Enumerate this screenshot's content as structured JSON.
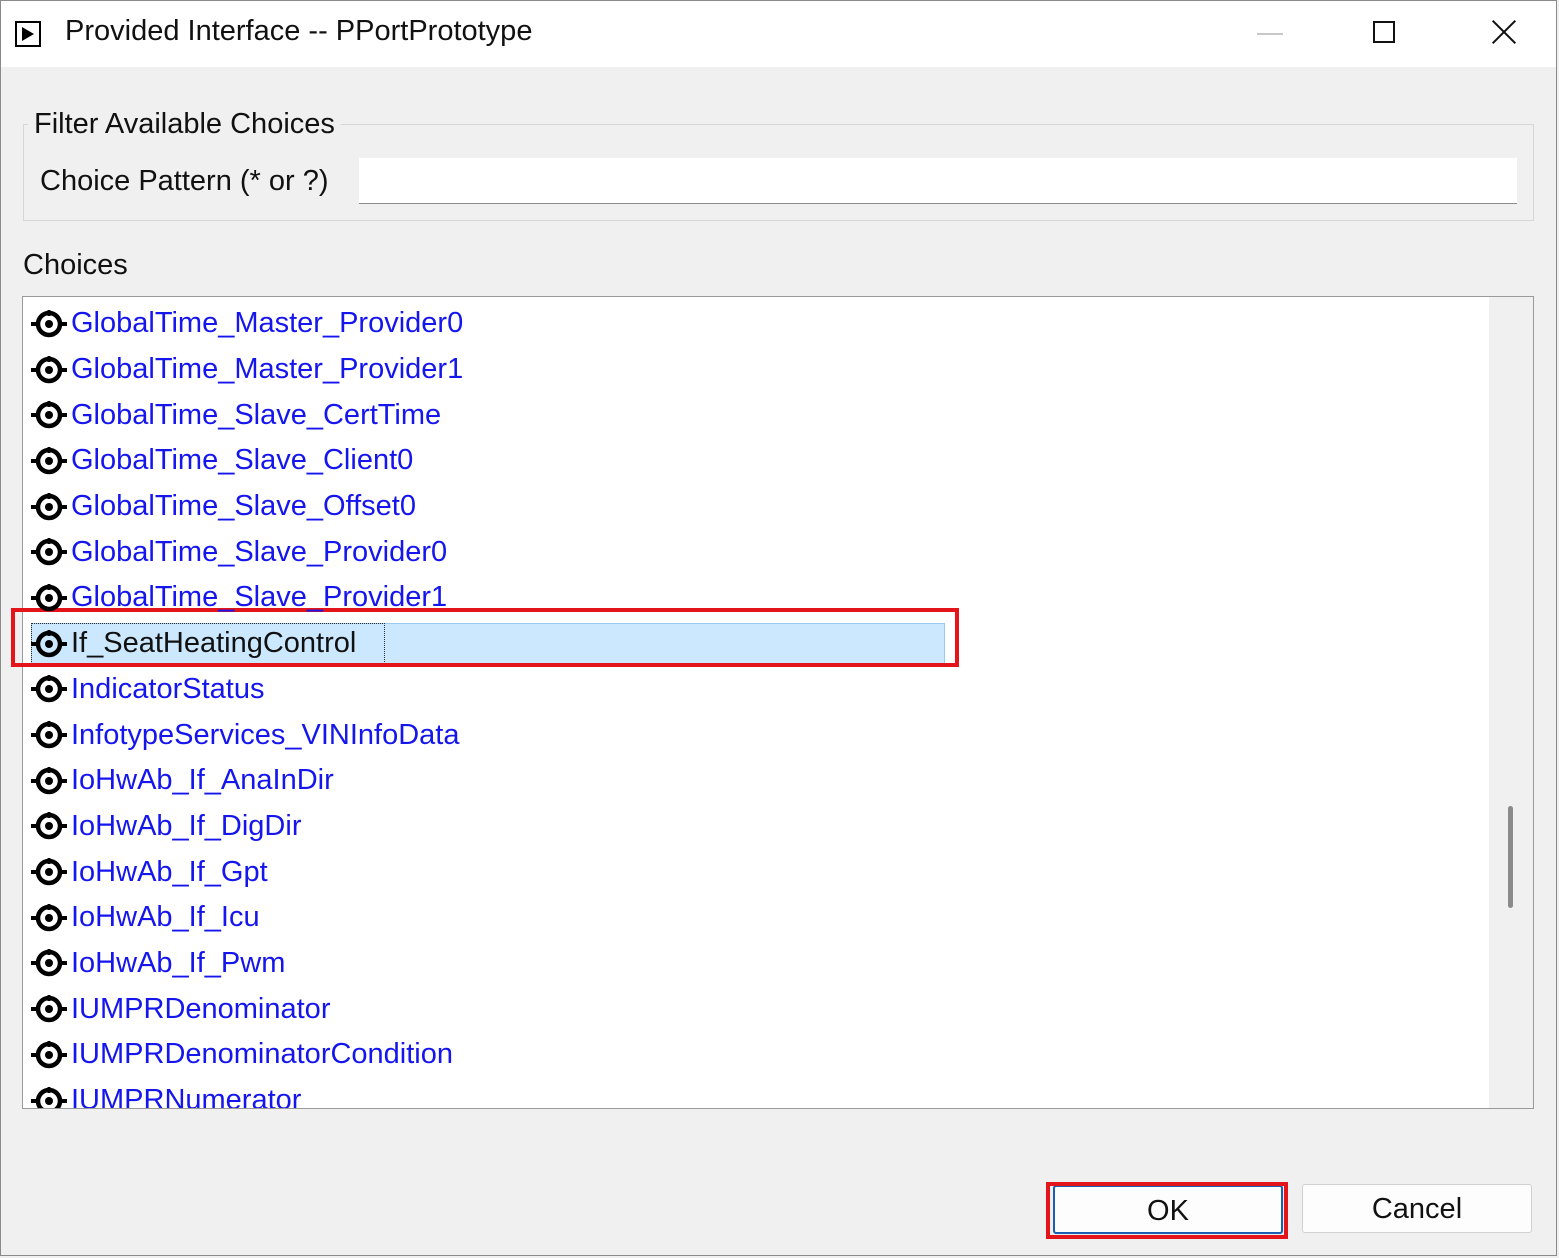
{
  "window": {
    "title": "Provided Interface -- PPortPrototype"
  },
  "filter": {
    "group_title": "Filter Available Choices",
    "pattern_label": "Choice Pattern (* or ?)",
    "pattern_value": ""
  },
  "choices": {
    "label": "Choices",
    "items": [
      {
        "label": "GlobalTime_Master_Provider0",
        "icon": "provided-interface-icon"
      },
      {
        "label": "GlobalTime_Master_Provider1",
        "icon": "provided-interface-icon"
      },
      {
        "label": "GlobalTime_Slave_CertTime",
        "icon": "provided-interface-icon"
      },
      {
        "label": "GlobalTime_Slave_Client0",
        "icon": "provided-interface-icon"
      },
      {
        "label": "GlobalTime_Slave_Offset0",
        "icon": "provided-interface-icon"
      },
      {
        "label": "GlobalTime_Slave_Provider0",
        "icon": "provided-interface-icon"
      },
      {
        "label": "GlobalTime_Slave_Provider1",
        "icon": "provided-interface-icon"
      },
      {
        "label": "If_SeatHeatingControl",
        "icon": "provided-interface-icon",
        "selected": true
      },
      {
        "label": "IndicatorStatus",
        "icon": "provided-interface-icon"
      },
      {
        "label": "InfotypeServices_VINInfoData",
        "icon": "provided-interface-icon"
      },
      {
        "label": "IoHwAb_If_AnaInDir",
        "icon": "provided-interface-icon"
      },
      {
        "label": "IoHwAb_If_DigDir",
        "icon": "provided-interface-icon"
      },
      {
        "label": "IoHwAb_If_Gpt",
        "icon": "provided-interface-icon"
      },
      {
        "label": "IoHwAb_If_Icu",
        "icon": "provided-interface-icon"
      },
      {
        "label": "IoHwAb_If_Pwm",
        "icon": "provided-interface-icon"
      },
      {
        "label": "IUMPRDenominator",
        "icon": "provided-interface-icon"
      },
      {
        "label": "IUMPRDenominatorCondition",
        "icon": "provided-interface-icon"
      },
      {
        "label": "IUMPRNumerator",
        "icon": "provided-interface-icon"
      }
    ]
  },
  "buttons": {
    "ok_label": "OK",
    "cancel_label": "Cancel"
  },
  "colors": {
    "link_text": "#1515ee",
    "selection_bg": "#cce8ff",
    "annotation_red": "#e4141b"
  }
}
